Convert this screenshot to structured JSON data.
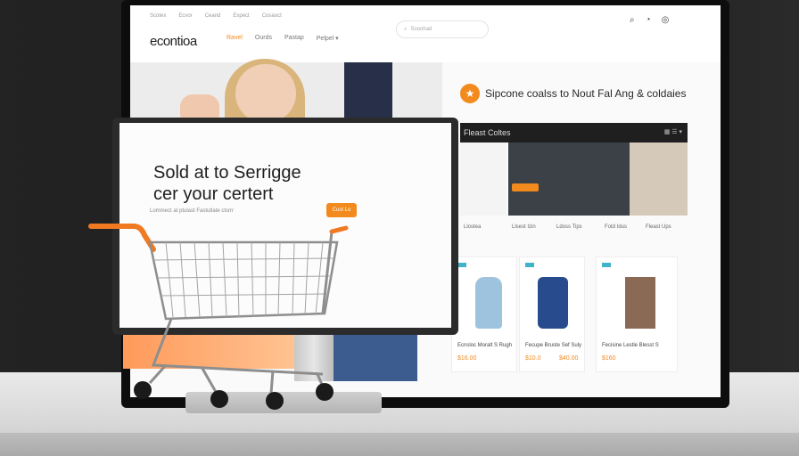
{
  "nav": {
    "top_links": [
      "Scotex",
      "Ecvor",
      "Ceand",
      "Expect",
      "Cosaoct"
    ],
    "logo": "econtioa",
    "menu": [
      "Ravel",
      "Ourds",
      "Pastap",
      "Pelpel ▾"
    ],
    "search_placeholder": "Sooohad",
    "icons": [
      "search-icon",
      "user-icon",
      "cart-icon"
    ]
  },
  "promo": {
    "icon": "★",
    "text": "Sipcone coalss to Nout Fal Ang & coldaies"
  },
  "strip": {
    "title": "Fleast Coltes",
    "controls": "▦ ☰ ▾"
  },
  "tile_labels": [
    "Llostea",
    "Llsest Izin",
    "Ldoss Tips",
    "Fotd Idus",
    "Fleast Ups"
  ],
  "cards": [
    {
      "name": "Ecnsloc Moralt S Rugh",
      "price": "$16.00"
    },
    {
      "name": "Fecupe Bruste Sef Suly",
      "price": "$10.0",
      "price2": "$40.00"
    },
    {
      "name": "Fecisine Lestle Blesst S",
      "price": "$160"
    }
  ],
  "small": {
    "headline_1": "Sold at to Serrigge",
    "headline_2": "cer your certert",
    "sub": "Lommect at ptulast Fastutlate ctsrrr",
    "button": "Cust Lo"
  },
  "colors": {
    "accent": "#f28a1e",
    "dark": "#1f1f1f",
    "tag": "#3fb4c9"
  }
}
